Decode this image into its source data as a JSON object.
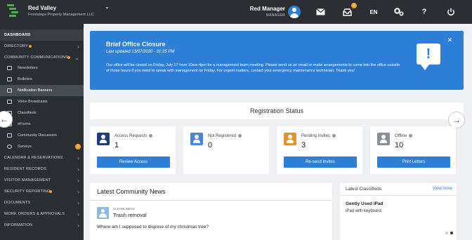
{
  "header": {
    "org_name": "Red Valley",
    "org_subtitle": "Frontsteps Property Management LLC",
    "user_name": "Red Manager",
    "user_role": "MANAGER",
    "inbox_badge": "2",
    "language": "EN"
  },
  "sidebar": {
    "items": [
      {
        "label": "DASHBOARD"
      },
      {
        "label": "DIRECTORY"
      },
      {
        "label": "COMMUNITY COMMUNICATIONS"
      },
      {
        "label": "CALENDAR & RESERVATIONS"
      },
      {
        "label": "RESIDENT RECORDS"
      },
      {
        "label": "VISITOR MANAGEMENT"
      },
      {
        "label": "SECURITY REPORTING"
      },
      {
        "label": "DOCUMENTS"
      },
      {
        "label": "WORK ORDERS & APPROVALS"
      },
      {
        "label": "INFORMATION"
      }
    ],
    "sub_items": [
      {
        "label": "Newsletters"
      },
      {
        "label": "Bulletins"
      },
      {
        "label": "Notification Banners"
      },
      {
        "label": "Voice Broadcasts"
      },
      {
        "label": "Classifieds"
      },
      {
        "label": "eForms"
      },
      {
        "label": "Community Discussion"
      },
      {
        "label": "Surveys",
        "badge": "1"
      }
    ]
  },
  "banner": {
    "title": "Brief Office Closure",
    "date": "Last updated 13/07/2020 - 01:25 PM",
    "body": "Our office will be closed on Friday, July 17 from 10am-4pm for a management team meeting. Please send us an email or make arrangements to come into the office outside of those hours if you need to speak with management on Friday. For urgent matters, contact your emergency maintenance technician. Thank you!"
  },
  "registration": {
    "title": "Registration Status",
    "cards": [
      {
        "label": "Access Requests",
        "value": "1",
        "button": "Review Access",
        "color": "#1f3f7a"
      },
      {
        "label": "Not Registered",
        "value": "0",
        "button": "",
        "color": "#4a86d6"
      },
      {
        "label": "Pending Invites",
        "value": "3",
        "button": "Re-send Invites",
        "color": "#e0932e"
      },
      {
        "label": "Offline",
        "value": "10",
        "button": "Print Letters",
        "color": "#8a8f95"
      }
    ]
  },
  "news": {
    "title": "Latest Community News",
    "category": "CLEANLINESS",
    "headline": "Trash removal",
    "body": "Where am I supposed to dispose of my christmas tree?"
  },
  "classifieds": {
    "title": "Latest Classifieds",
    "view_more": "View more",
    "item_title": "Gently Used iPad",
    "item_desc": "iPad with keyboard."
  },
  "colors": {
    "accent": "#2d7fd8",
    "sidebar_bg": "#2b2f33",
    "badge": "#f0a030"
  }
}
